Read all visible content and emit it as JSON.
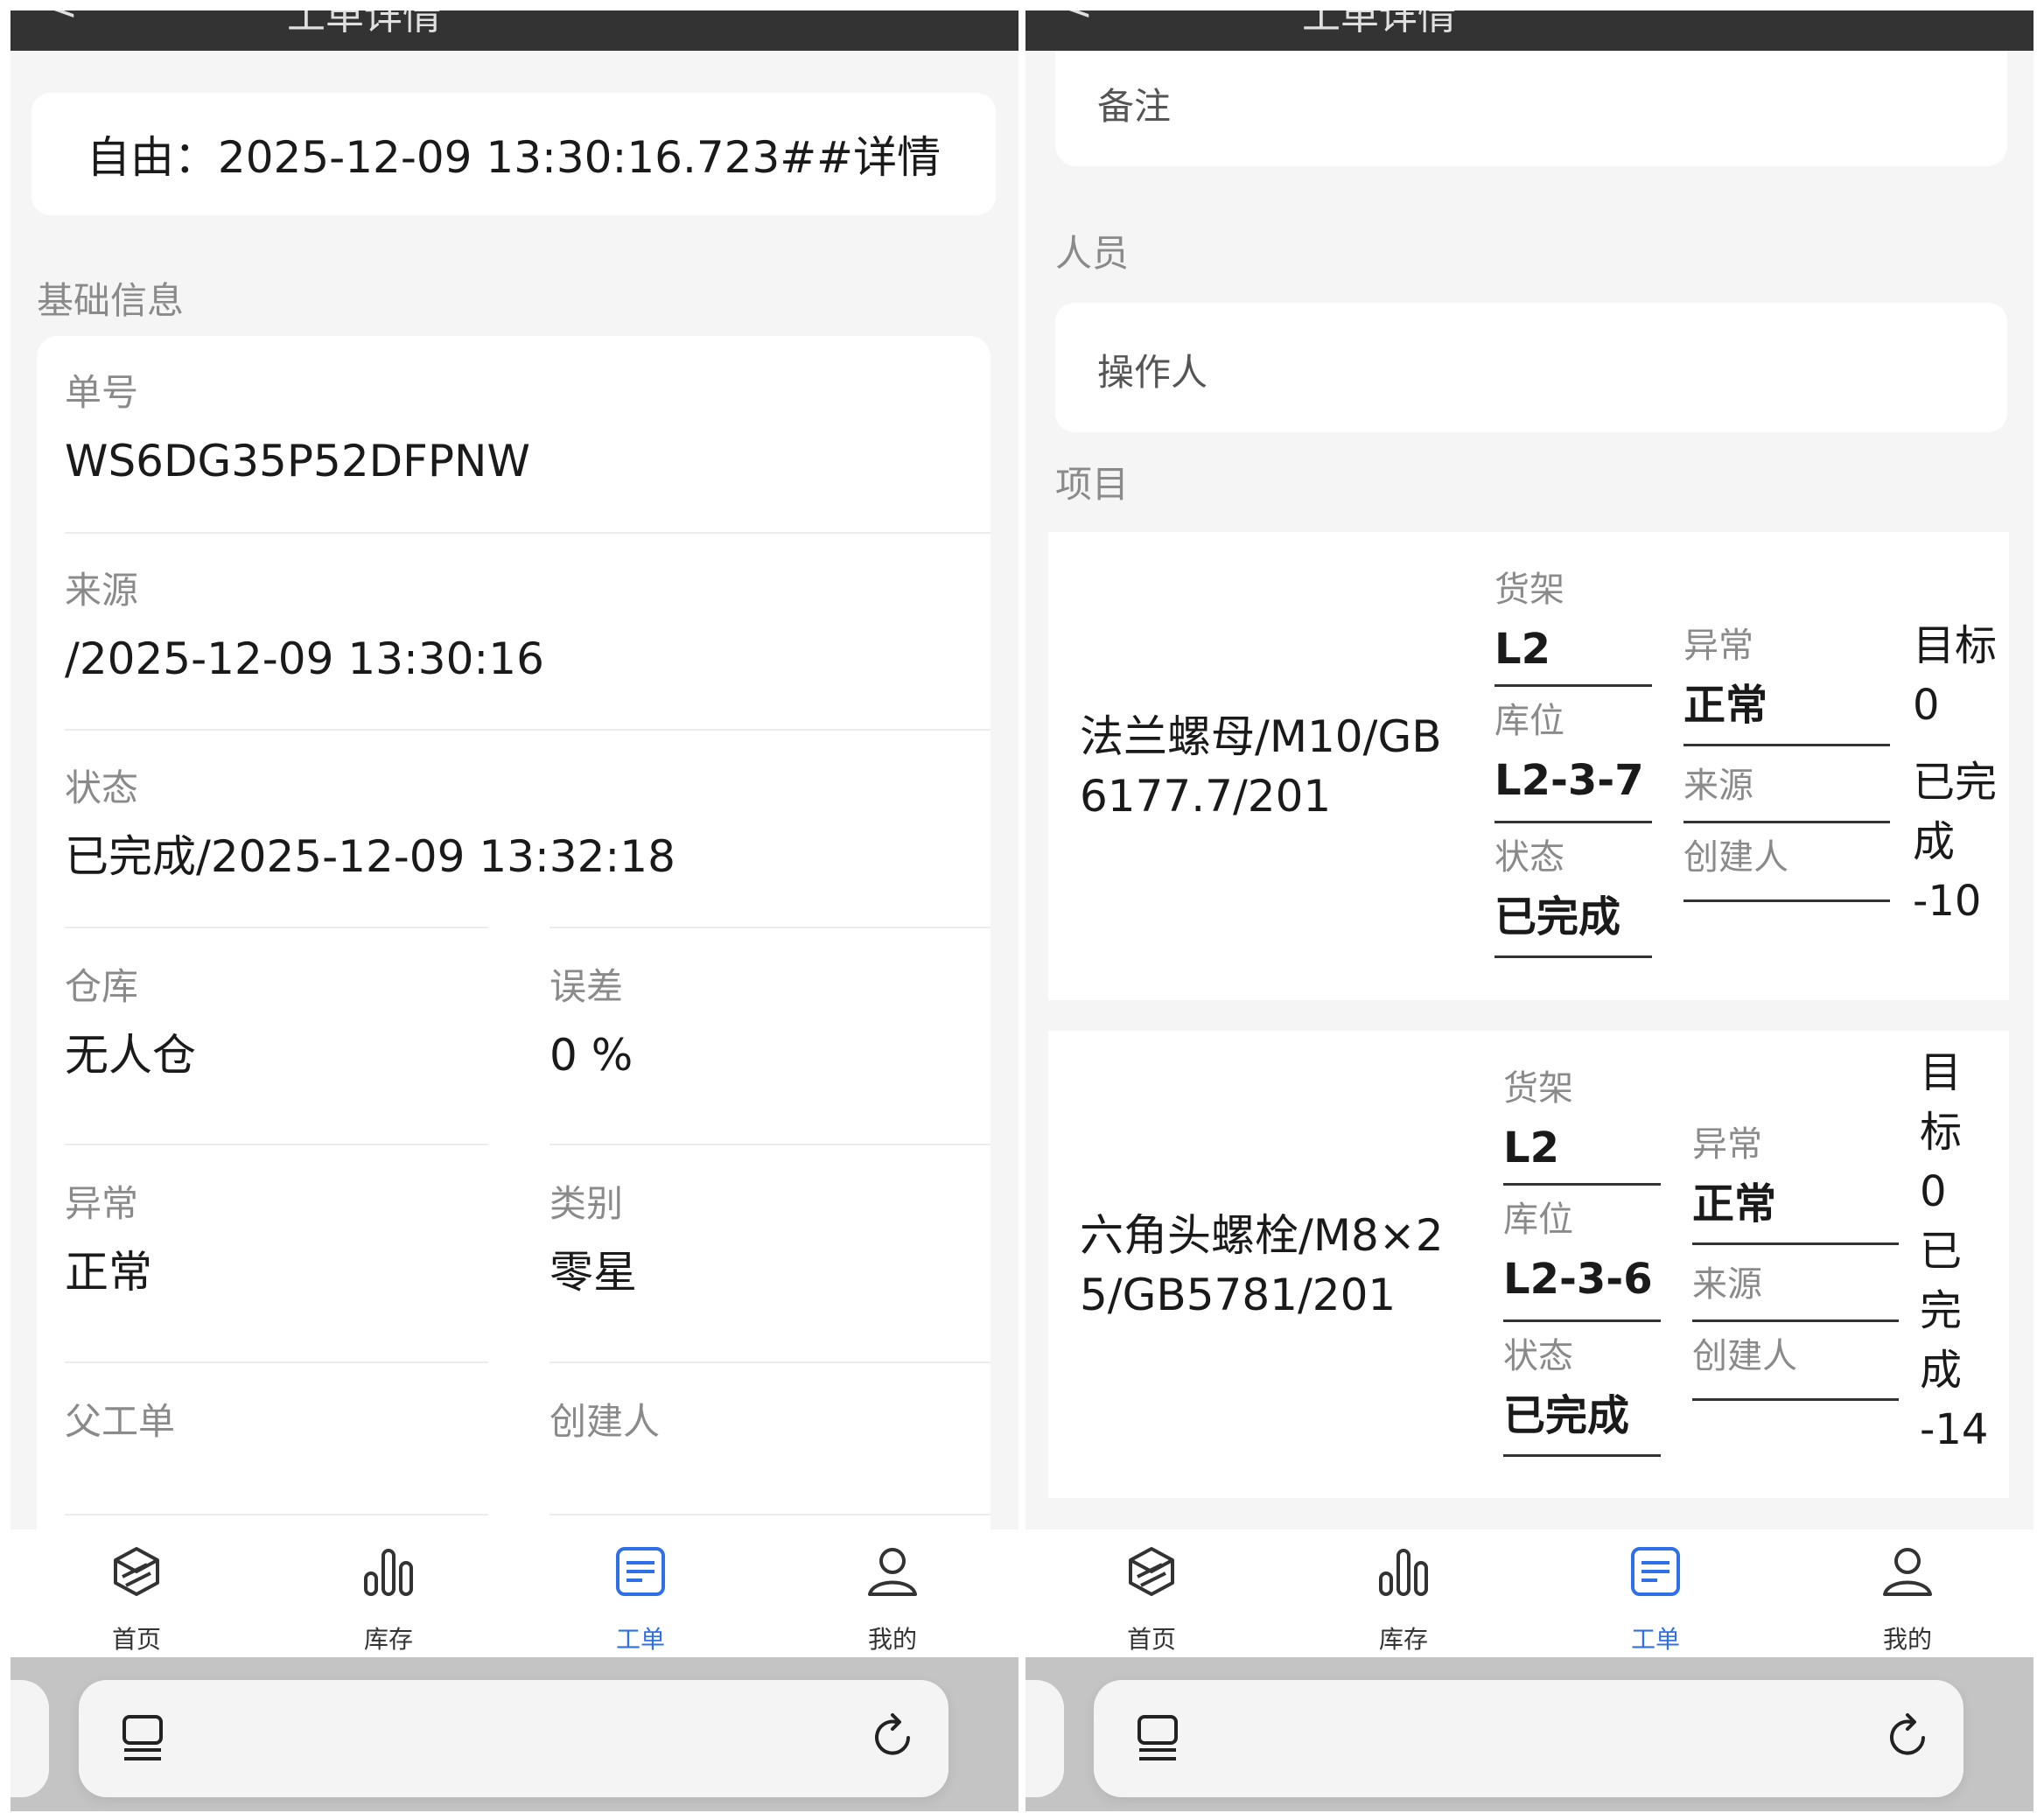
{
  "header": {
    "title_fragment": "工单详情",
    "back": "<"
  },
  "title_card": {
    "text": "自由：2025-12-09 13:30:16.723##详情"
  },
  "basic_info": {
    "section_label": "基础信息",
    "order_no_label": "单号",
    "order_no": "WS6DG35P52DFPNW",
    "source_label": "来源",
    "source": "/2025-12-09 13:30:16",
    "status_label": "状态",
    "status": "已完成/2025-12-09 13:32:18",
    "warehouse_label": "仓库",
    "warehouse": "无人仓",
    "error_label": "误差",
    "error": "0 %",
    "exception_label": "异常",
    "exception": "正常",
    "category_label": "类别",
    "category": "零星",
    "parent_label": "父工单",
    "creator_label": "创建人"
  },
  "remark": {
    "label": "备注"
  },
  "personnel": {
    "section_label": "人员",
    "operator_label": "操作人"
  },
  "items": {
    "section_label": "项目",
    "list": [
      {
        "name_line1": "法兰螺母/M10/GB",
        "name_line2": "6177.7/201",
        "shelf_label": "货架",
        "shelf": "L2",
        "location_label": "库位",
        "location": "L2-3-7",
        "status_label": "状态",
        "status": "已完成",
        "exception_label": "异常",
        "exception": "正常",
        "source_label": "来源",
        "creator_label": "创建人",
        "target_lines": [
          "目标",
          "0",
          "已完",
          "成",
          "-10"
        ]
      },
      {
        "name_line1": "六角头螺栓/M8×2",
        "name_line2": "5/GB5781/201",
        "shelf_label": "货架",
        "shelf": "L2",
        "location_label": "库位",
        "location": "L2-3-6",
        "status_label": "状态",
        "status": "已完成",
        "exception_label": "异常",
        "exception": "正常",
        "source_label": "来源",
        "creator_label": "创建人",
        "target_lines": [
          "目",
          "标",
          "0",
          "已",
          "完",
          "成",
          "-14"
        ]
      }
    ]
  },
  "tabbar": {
    "home": "首页",
    "inventory": "库存",
    "workorder": "工单",
    "mine": "我的",
    "active_color": "#2f6fe8"
  }
}
